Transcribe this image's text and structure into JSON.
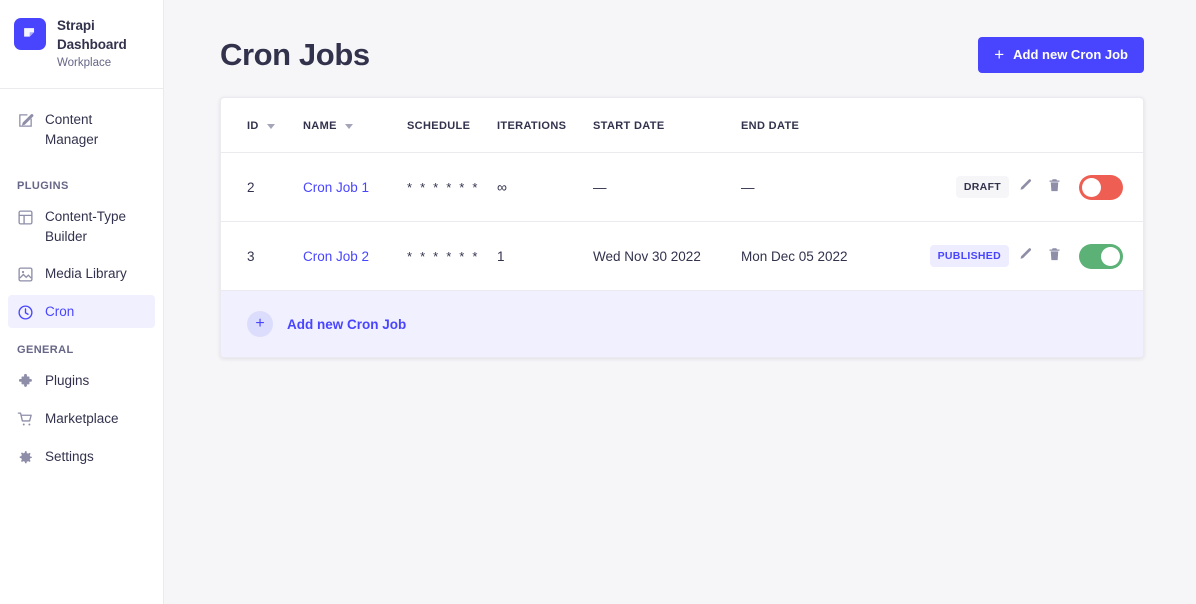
{
  "sidebar": {
    "brand": {
      "logo_icon": "strapi-logo-icon",
      "title": "Strapi Dashboard",
      "subtitle": "Workplace",
      "logo_color": "#4945ff"
    },
    "items": [
      {
        "label": "Content Manager",
        "icon": "edit-square-icon",
        "active": false
      },
      {
        "label": "Content-Type Builder",
        "icon": "layout-icon",
        "active": false
      },
      {
        "label": "Media Library",
        "icon": "image-icon",
        "active": false
      },
      {
        "label": "Cron",
        "icon": "clock-icon",
        "active": true
      },
      {
        "label": "Plugins",
        "icon": "puzzle-icon",
        "active": false
      },
      {
        "label": "Marketplace",
        "icon": "shopping-cart-icon",
        "active": false
      },
      {
        "label": "Settings",
        "icon": "gear-icon",
        "active": false
      }
    ],
    "sections": {
      "plugins": "PLUGINS",
      "general": "GENERAL"
    }
  },
  "header": {
    "title": "Cron Jobs",
    "add_button": {
      "label": "Add new Cron Job",
      "icon": "plus-icon",
      "color": "#4945ff"
    }
  },
  "table": {
    "columns": [
      {
        "label": "ID",
        "sortable": true
      },
      {
        "label": "NAME",
        "sortable": true
      },
      {
        "label": "SCHEDULE",
        "sortable": false
      },
      {
        "label": "ITERATIONS",
        "sortable": false
      },
      {
        "label": "START DATE",
        "sortable": false
      },
      {
        "label": "END DATE",
        "sortable": false
      }
    ],
    "rows": [
      {
        "id": "2",
        "name": "Cron Job 1",
        "schedule": "* * * * * *",
        "iterations": "∞",
        "start_date": "—",
        "end_date": "—",
        "status": "DRAFT",
        "status_kind": "draft",
        "enabled": false,
        "edit_icon": "pencil-icon",
        "delete_icon": "trash-icon"
      },
      {
        "id": "3",
        "name": "Cron Job 2",
        "schedule": "* * * * * *",
        "iterations": "1",
        "start_date": "Wed Nov 30 2022",
        "end_date": "Mon Dec 05 2022",
        "status": "PUBLISHED",
        "status_kind": "published",
        "enabled": true,
        "edit_icon": "pencil-icon",
        "delete_icon": "trash-icon"
      }
    ],
    "footer": {
      "label": "Add new Cron Job",
      "icon": "plus-icon"
    }
  },
  "colors": {
    "accent": "#4945ff",
    "toggle_off": "#ee5e52",
    "toggle_on": "#5cb176",
    "page_bg": "#f6f6f9",
    "text": "#32324d"
  }
}
